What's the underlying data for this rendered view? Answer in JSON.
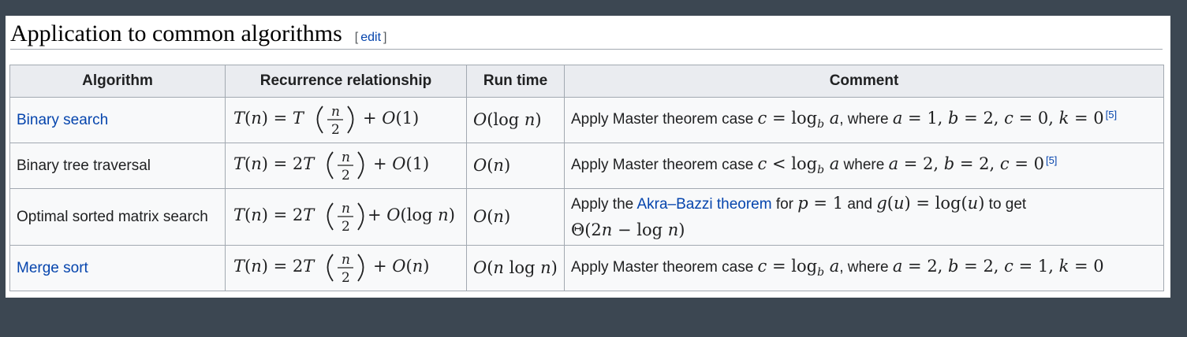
{
  "section": {
    "title": "Application to common algorithms",
    "edit_open": "[",
    "edit_label": "edit",
    "edit_close": "]"
  },
  "table": {
    "headers": [
      "Algorithm",
      "Recurrence relationship",
      "Run time",
      "Comment"
    ],
    "rows": [
      {
        "algorithm": "Binary search",
        "recurrence": "T(n) = T(n/2) + O(1)",
        "runtime": "O(log n)",
        "comment_text": "Apply Master theorem case",
        "comment_math_1": "c = log_b a",
        "comment_mid": ", where",
        "comment_math_2": "a = 1, b = 2, c = 0, k = 0",
        "ref": "[5]"
      },
      {
        "algorithm": "Binary tree traversal",
        "recurrence": "T(n) = 2T(n/2) + O(1)",
        "runtime": "O(n)",
        "comment_text": "Apply Master theorem case",
        "comment_math_1": "c < log_b a",
        "comment_mid": "where",
        "comment_math_2": "a = 2, b = 2, c = 0",
        "ref": "[5]"
      },
      {
        "algorithm": "Optimal sorted matrix search",
        "recurrence": "T(n) = 2T(n/2) + O(log n)",
        "runtime": "O(n)",
        "comment_prefix": "Apply the",
        "comment_link": "Akra–Bazzi theorem",
        "comment_for": "for",
        "comment_math_p": "p = 1",
        "comment_and": "and",
        "comment_math_g": "g(u) = log(u)",
        "comment_to_get": "to get",
        "comment_math_theta": "Θ(2n − log n)"
      },
      {
        "algorithm": "Merge sort",
        "recurrence": "T(n) = 2T(n/2) + O(n)",
        "runtime": "O(n log n)",
        "comment_text": "Apply Master theorem case",
        "comment_math_1": "c = log_b a",
        "comment_mid": ", where",
        "comment_math_2": "a = 2, b = 2, c = 1, k = 0"
      }
    ]
  }
}
